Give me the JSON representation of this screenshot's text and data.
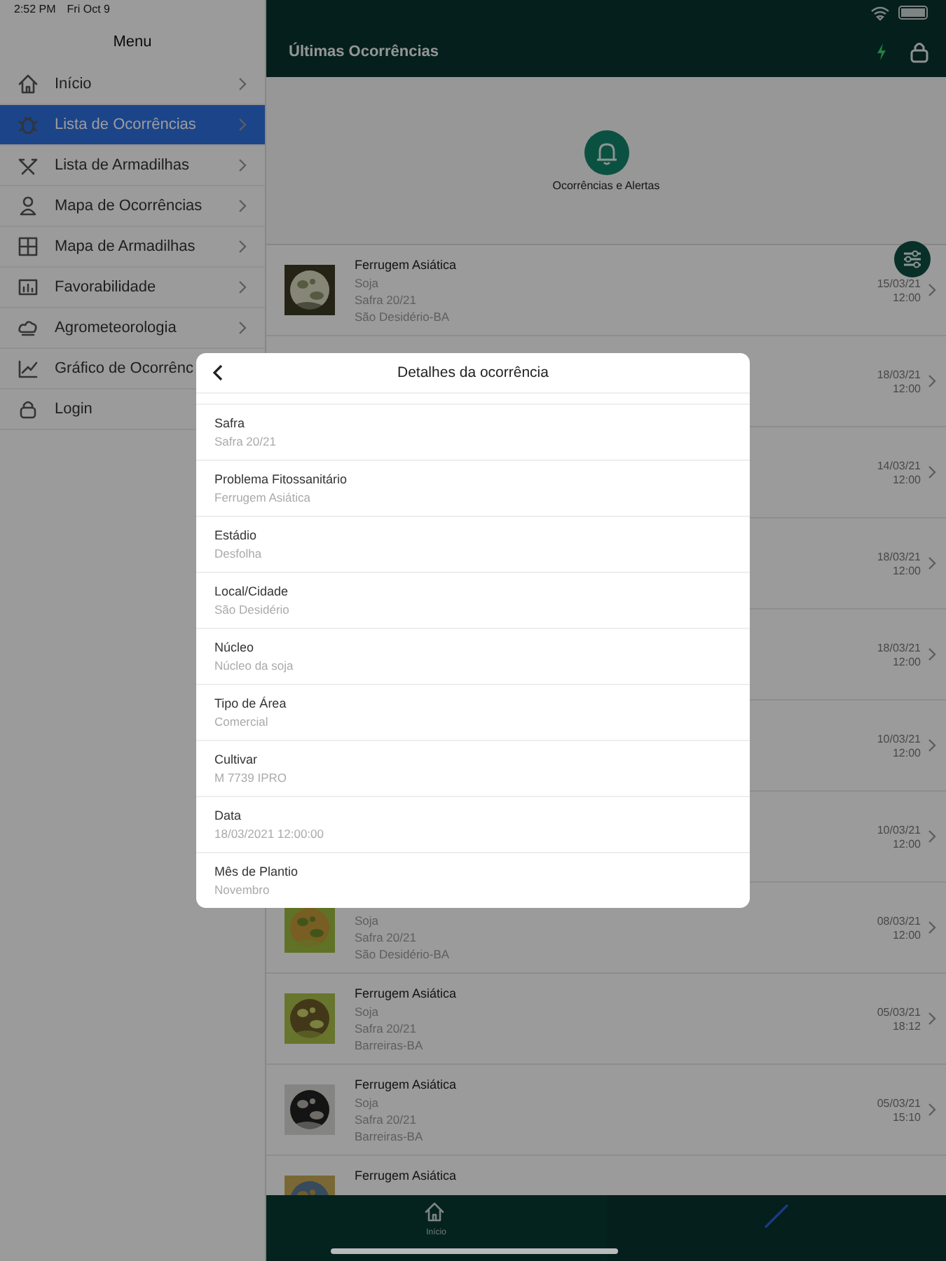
{
  "status_bar": {
    "time": "2:52 PM",
    "date": "Fri Oct 9"
  },
  "menu": {
    "title": "Menu",
    "items": [
      {
        "label": "Início",
        "selected": false,
        "chevron": true
      },
      {
        "label": "Lista de Ocorrências",
        "selected": true,
        "chevron": true
      },
      {
        "label": "Lista de Armadilhas",
        "selected": false,
        "chevron": true
      },
      {
        "label": "Mapa de Ocorrências",
        "selected": false,
        "chevron": true
      },
      {
        "label": "Mapa de Armadilhas",
        "selected": false,
        "chevron": true
      },
      {
        "label": "Favorabilidade",
        "selected": false,
        "chevron": true
      },
      {
        "label": "Agrometeorologia",
        "selected": false,
        "chevron": true
      },
      {
        "label": "Gráfico de Ocorrênc",
        "selected": false
      },
      {
        "label": "Login",
        "selected": false
      }
    ]
  },
  "header": {
    "title": "Últimas Ocorrências"
  },
  "banner": {
    "label": "Ocorrências e Alertas"
  },
  "rows": [
    {
      "thumbnail": true,
      "title": "Ferrugem Asiática",
      "crop": "Soja",
      "season": "Safra 20/21",
      "place": "São Desidério-BA",
      "date": "15/03/21",
      "time": "12:00"
    },
    {
      "date": "18/03/21",
      "time": "12:00"
    },
    {
      "date": "14/03/21",
      "time": "12:00"
    },
    {
      "date": "18/03/21",
      "time": "12:00"
    },
    {
      "date": "18/03/21",
      "time": "12:00"
    },
    {
      "date": "10/03/21",
      "time": "12:00"
    },
    {
      "date": "10/03/21",
      "time": "12:00"
    },
    {
      "thumbnail": true,
      "crop": "Soja",
      "season": "Safra 20/21",
      "place": "São Desidério-BA",
      "date": "08/03/21",
      "time": "12:00"
    },
    {
      "thumbnail": true,
      "title": "Ferrugem Asiática",
      "crop": "Soja",
      "season": "Safra 20/21",
      "place": "Barreiras-BA",
      "date": "05/03/21",
      "time": "18:12"
    },
    {
      "thumbnail": true,
      "title": "Ferrugem Asiática",
      "crop": "Soja",
      "season": "Safra 20/21",
      "place": "Barreiras-BA",
      "date": "05/03/21",
      "time": "15:10"
    },
    {
      "thumbnail": true,
      "title": "Ferrugem Asiática"
    }
  ],
  "tab_bar": {
    "tabs": [
      {
        "label": "Início",
        "selected": true
      },
      {
        "selected": false
      }
    ]
  },
  "dialog": {
    "title": "Detalhes da ocorrência",
    "fields": [
      {
        "label": "Safra",
        "value": "Safra 20/21"
      },
      {
        "label": "Problema Fitossanitário",
        "value": "Ferrugem Asiática"
      },
      {
        "label": "Estádio",
        "value": "Desfolha"
      },
      {
        "label": "Local/Cidade",
        "value": "São Desidério"
      },
      {
        "label": "Núcleo",
        "value": "Núcleo da soja"
      },
      {
        "label": "Tipo de Área",
        "value": "Comercial"
      },
      {
        "label": "Cultivar",
        "value": "M 7739 IPRO"
      },
      {
        "label": "Data",
        "value": "18/03/2021 12:00:00"
      },
      {
        "label": "Mês de Plantio",
        "value": "Novembro"
      }
    ]
  }
}
